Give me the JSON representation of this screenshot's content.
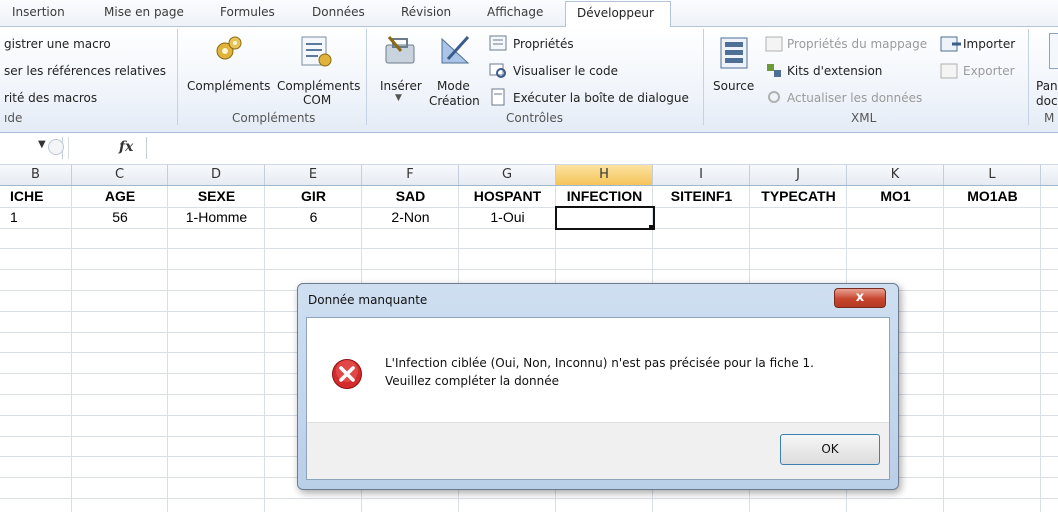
{
  "ribbon": {
    "tabs": [
      "Insertion",
      "Mise en page",
      "Formules",
      "Données",
      "Révision",
      "Affichage",
      "Développeur"
    ],
    "code_items": [
      "gistrer une macro",
      "ser les références relatives",
      "rité des macros"
    ],
    "code_group_label": "ıde",
    "addins": {
      "complements": "Compléments",
      "com_line1": "Compléments",
      "com_line2": "COM",
      "group_label": "Compléments"
    },
    "controls": {
      "inserer": "Insérer",
      "mode_line1": "Mode",
      "mode_line2": "Création",
      "proprietes": "Propriétés",
      "visualiser": "Visualiser le code",
      "executer": "Exécuter la boîte de dialogue",
      "group_label": "Contrôles"
    },
    "xml": {
      "source": "Source",
      "proprietes_mappage": "Propriétés du mappage",
      "importer": "Importer",
      "kits": "Kits d'extension",
      "exporter": "Exporter",
      "actualiser": "Actualiser les données",
      "group_label": "XML"
    },
    "modify": {
      "line1": "Pan",
      "line2": "doc",
      "group_label": "M"
    }
  },
  "formula_bar": {
    "fx": "fx"
  },
  "sheet": {
    "columns": [
      "B",
      "C",
      "D",
      "E",
      "F",
      "G",
      "H",
      "I",
      "J",
      "K",
      "L"
    ],
    "selected_column": "H",
    "header_row": [
      "ICHE",
      "AGE",
      "SEXE",
      "GIR",
      "SAD",
      "HOSPANT",
      "INFECTION",
      "SITEINF1",
      "TYPECATH",
      "MO1",
      "MO1AB"
    ],
    "data_row": [
      "1",
      "56",
      "1-Homme",
      "6",
      "2-Non",
      "1-Oui",
      "",
      "",
      "",
      "",
      ""
    ]
  },
  "dialog": {
    "title": "Donnée manquante",
    "close": "x",
    "message_line1": "L'Infection ciblée (Oui, Non, Inconnu) n'est pas précisée pour la fiche 1.",
    "message_line2": "Veuillez compléter la donnée",
    "ok": "OK"
  },
  "colors": {
    "error": "#d42b2b",
    "selected_column": "#f6c45a",
    "ok_border": "#3c7fb1"
  }
}
